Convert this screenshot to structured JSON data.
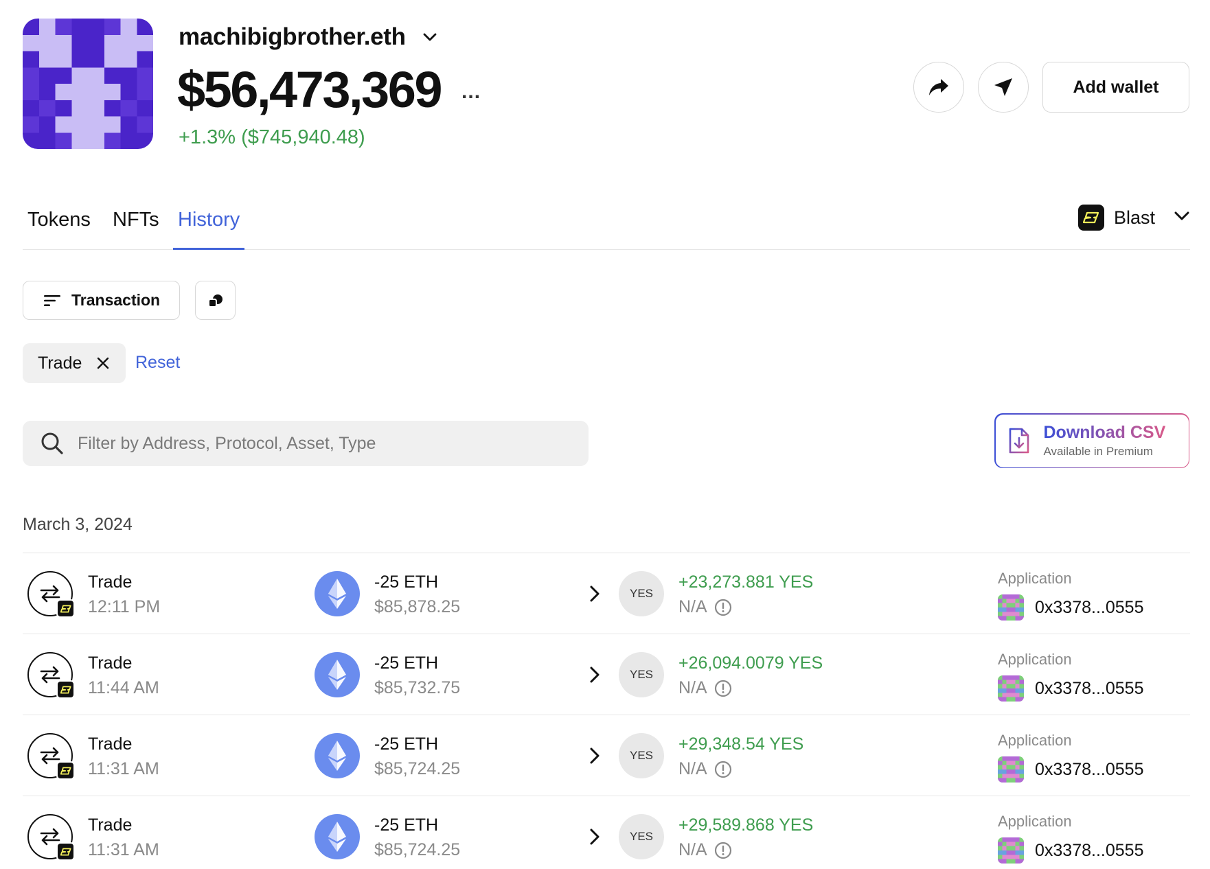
{
  "profile": {
    "ens_name": "machibigbrother.eth",
    "balance": "$56,473,369",
    "more": "...",
    "change": "+1.3% ($745,940.48)"
  },
  "actions": {
    "add_wallet": "Add wallet"
  },
  "tabs": [
    {
      "label": "Tokens",
      "active": false
    },
    {
      "label": "NFTs",
      "active": false
    },
    {
      "label": "History",
      "active": true
    }
  ],
  "network": {
    "label": "Blast"
  },
  "filters": {
    "transaction_label": "Transaction",
    "chip_label": "Trade",
    "reset_label": "Reset"
  },
  "search": {
    "placeholder": "Filter by Address, Protocol, Asset, Type"
  },
  "csv": {
    "title": "Download CSV",
    "subtitle": "Available in Premium"
  },
  "history": {
    "date": "March 3, 2024",
    "transactions": [
      {
        "type": "Trade",
        "time": "12:11 PM",
        "out_amount": "-25 ETH",
        "out_usd": "$85,878.25",
        "in_token": "YES",
        "in_amount": "+23,273.881 YES",
        "in_usd": "N/A",
        "app_label": "Application",
        "app_address": "0x3378...0555"
      },
      {
        "type": "Trade",
        "time": "11:44 AM",
        "out_amount": "-25 ETH",
        "out_usd": "$85,732.75",
        "in_token": "YES",
        "in_amount": "+26,094.0079 YES",
        "in_usd": "N/A",
        "app_label": "Application",
        "app_address": "0x3378...0555"
      },
      {
        "type": "Trade",
        "time": "11:31 AM",
        "out_amount": "-25 ETH",
        "out_usd": "$85,724.25",
        "in_token": "YES",
        "in_amount": "+29,348.54 YES",
        "in_usd": "N/A",
        "app_label": "Application",
        "app_address": "0x3378...0555"
      },
      {
        "type": "Trade",
        "time": "11:31 AM",
        "out_amount": "-25 ETH",
        "out_usd": "$85,724.25",
        "in_token": "YES",
        "in_amount": "+29,589.868 YES",
        "in_usd": "N/A",
        "app_label": "Application",
        "app_address": "0x3378...0555"
      }
    ]
  },
  "colors": {
    "accent": "#4163d9",
    "positive": "#3f9d4f",
    "avatar_dark": "#4a24c9",
    "avatar_light": "#c9bdf5"
  }
}
